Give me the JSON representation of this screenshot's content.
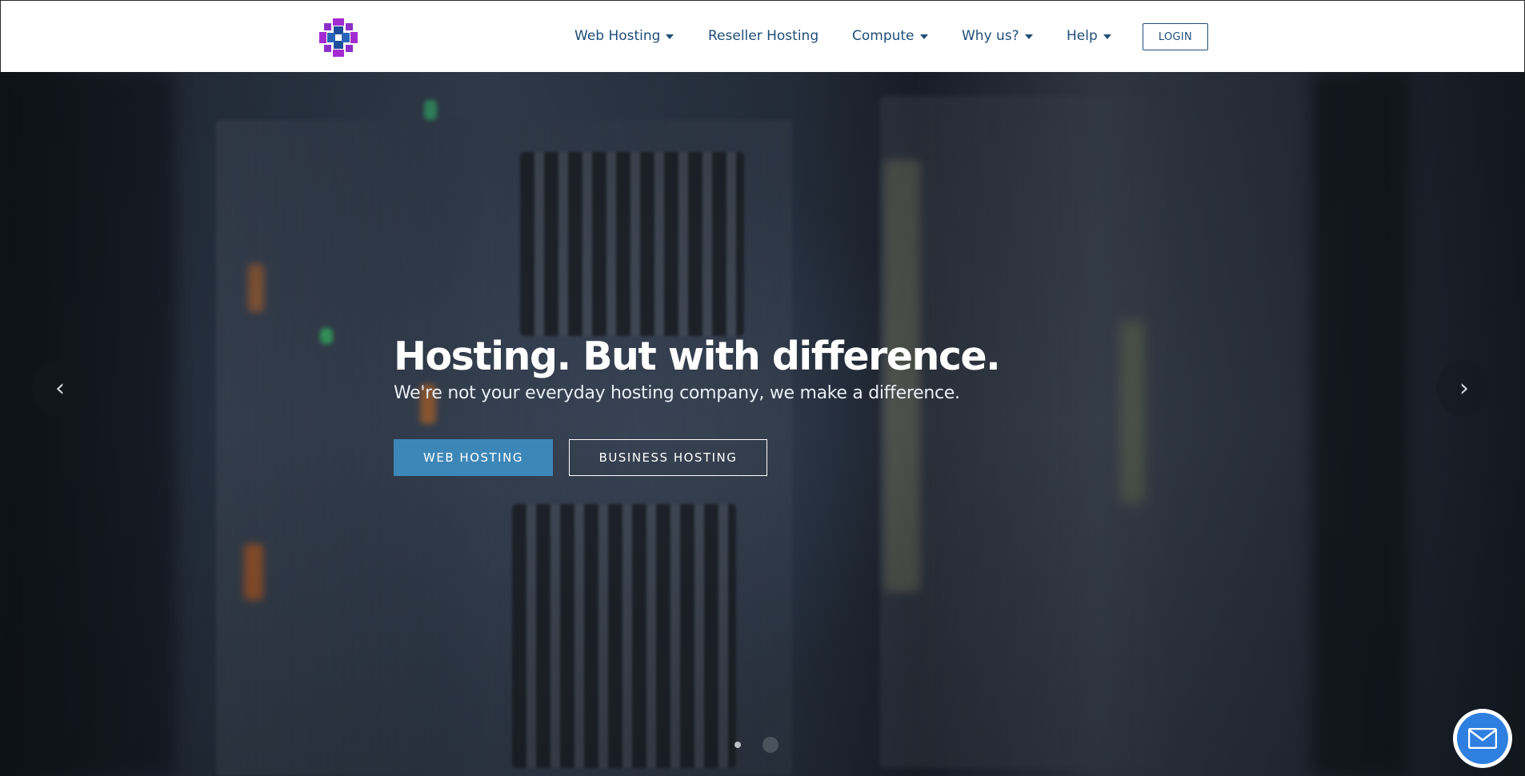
{
  "header": {
    "logo_name": "brand-logo",
    "nav": [
      {
        "label": "Web Hosting",
        "dropdown": true
      },
      {
        "label": "Reseller Hosting",
        "dropdown": false
      },
      {
        "label": "Compute",
        "dropdown": true
      },
      {
        "label": "Why us?",
        "dropdown": true
      },
      {
        "label": "Help",
        "dropdown": true
      }
    ],
    "login_label": "LOGIN"
  },
  "hero": {
    "title": "Hosting. But with difference.",
    "subtitle": "We're not your everyday hosting company, we make a difference.",
    "primary_button": "WEB HOSTING",
    "secondary_button": "BUSINESS HOSTING",
    "prev_arrow": "‹",
    "next_arrow": "›",
    "slides_total": 2,
    "active_slide": 2
  },
  "colors": {
    "nav_text": "#1f4e79",
    "primary_button": "#3d87b8",
    "chat_button": "#2f7fe0",
    "logo_purple": "#a42bd1",
    "logo_blue": "#1f4e9a"
  },
  "icons": {
    "chat": "envelope-icon",
    "prev": "chevron-left-icon",
    "next": "chevron-right-icon",
    "dropdown": "caret-down-icon"
  }
}
